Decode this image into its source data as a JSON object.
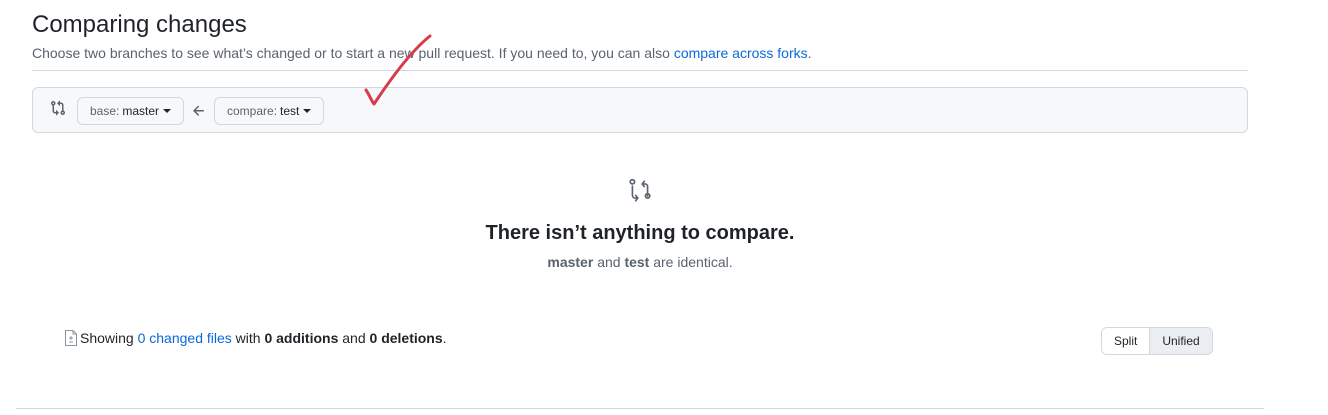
{
  "header": {
    "title": "Comparing changes",
    "subtitle_pre": "Choose two branches to see what’s changed or to start a new pull request. If you need to, you can also",
    "subtitle_link": "compare across forks",
    "subtitle_post": "."
  },
  "range": {
    "base_label": "base:",
    "base_branch": "master",
    "compare_label": "compare:",
    "compare_branch": "test"
  },
  "blankslate": {
    "title": "There isn’t anything to compare.",
    "branch_a": "master",
    "mid_text": "and",
    "branch_b": "test",
    "end_text": "are identical."
  },
  "toc": {
    "showing": "Showing",
    "changed_files": "0 changed files",
    "with": "with",
    "additions": "0 additions",
    "and": "and",
    "deletions": "0 deletions",
    "period": "."
  },
  "view_toggle": {
    "split": "Split",
    "unified": "Unified",
    "selected": "Unified"
  },
  "annotation": {
    "mark": "check-mark",
    "color": "#d73a49"
  },
  "icons": {
    "range": "git-compare-icon",
    "arrow": "arrow-left-icon",
    "file": "file-diff-icon"
  },
  "colors": {
    "link": "#0969da",
    "border": "#d1d9e0",
    "muted": "#59636e"
  }
}
